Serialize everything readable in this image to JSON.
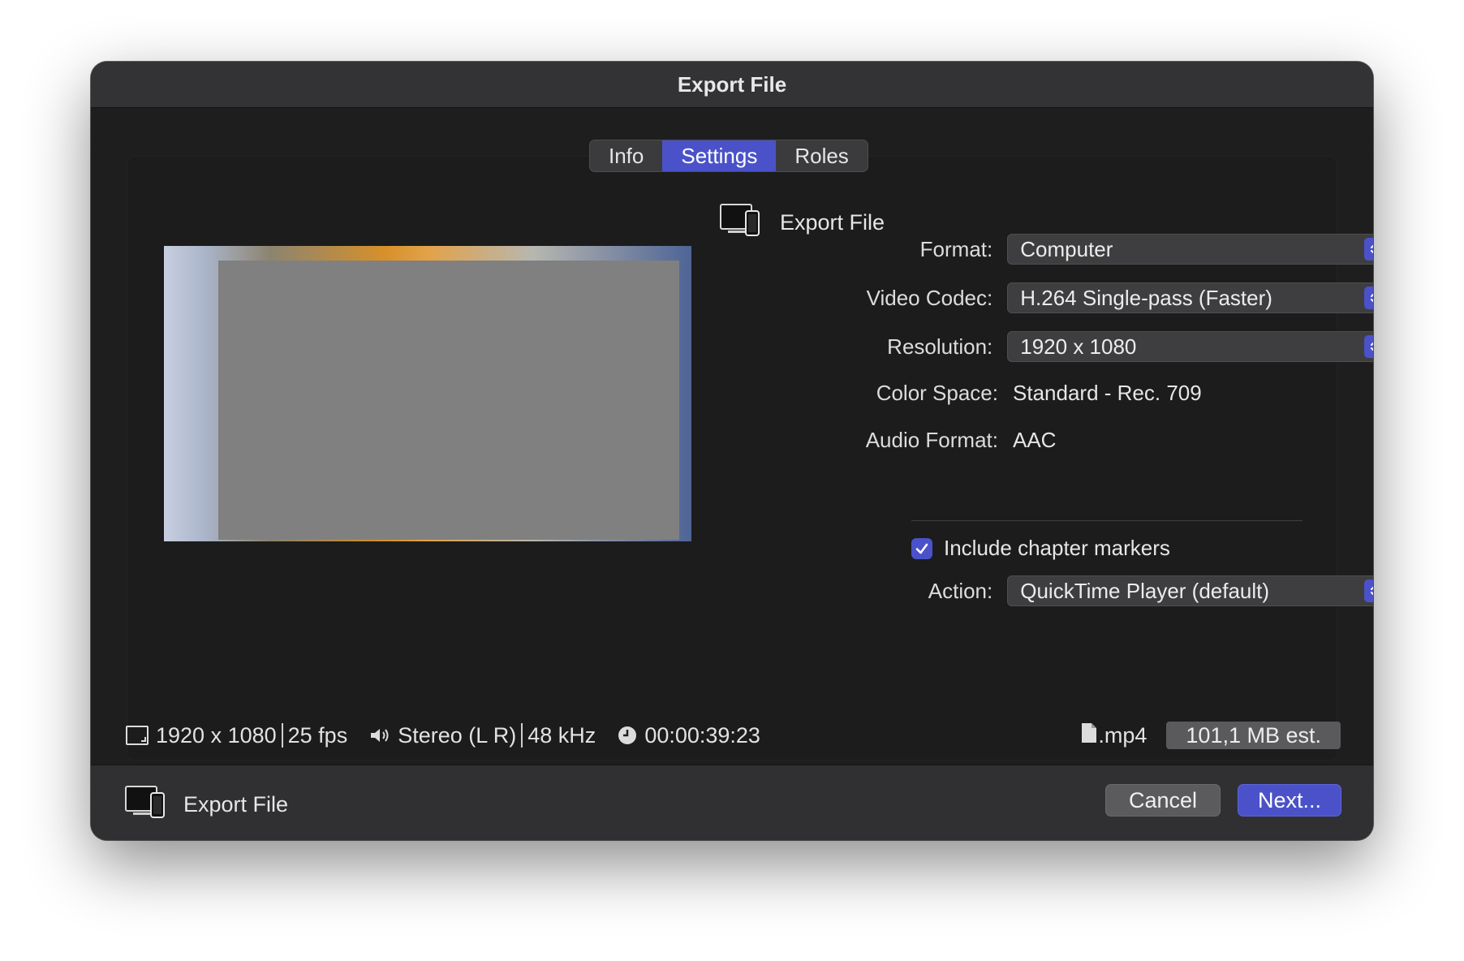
{
  "window": {
    "title": "Export File"
  },
  "tabs": [
    {
      "label": "Info",
      "active": false
    },
    {
      "label": "Settings",
      "active": true
    },
    {
      "label": "Roles",
      "active": false
    }
  ],
  "destination": {
    "icon": "computer-device-icon",
    "label": "Export File"
  },
  "settings": {
    "format": {
      "label": "Format:",
      "value": "Computer"
    },
    "video_codec": {
      "label": "Video Codec:",
      "value": "H.264 Single-pass (Faster)"
    },
    "resolution": {
      "label": "Resolution:",
      "value": "1920 x 1080"
    },
    "color_space": {
      "label": "Color Space:",
      "value": "Standard - Rec. 709"
    },
    "audio_format": {
      "label": "Audio Format:",
      "value": "AAC"
    },
    "chapter_markers": {
      "label": "Include chapter markers",
      "checked": true
    },
    "action": {
      "label": "Action:",
      "value": "QuickTime Player (default)"
    }
  },
  "info_bar": {
    "resolution": "1920 x 1080",
    "fps": "25 fps",
    "audio_channels": "Stereo (L R)",
    "sample_rate": "48 kHz",
    "duration": "00:00:39:23",
    "extension": ".mp4",
    "estimated_size": "101,1 MB est."
  },
  "footer": {
    "destination_label": "Export File",
    "cancel_label": "Cancel",
    "next_label": "Next..."
  },
  "colors": {
    "accent": "#4b52c9",
    "background": "#1e1e1e",
    "titlebar": "#333335"
  }
}
